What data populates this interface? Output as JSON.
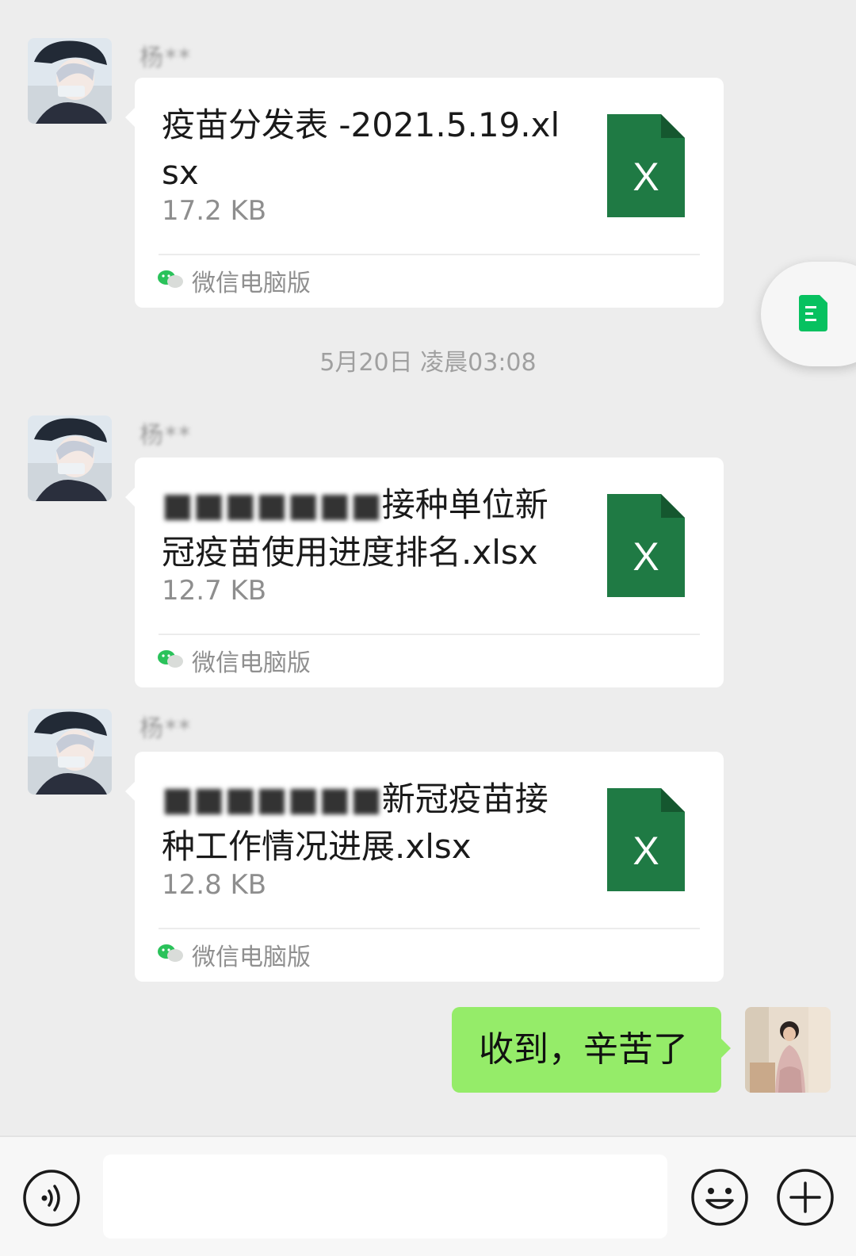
{
  "messages": [
    {
      "sender_name": "杨**",
      "file_name": "疫苗分发表 -2021.5.19.xlsx",
      "file_name_redacted": "",
      "file_size": "17.2 KB",
      "file_icon_letter": "X",
      "source_label": "微信电脑版"
    },
    {
      "sender_name": "杨**",
      "file_name": "接种单位新冠疫苗使用进度排名.xlsx",
      "file_name_redacted": "■■■■■■■",
      "file_size": "12.7 KB",
      "file_icon_letter": "X",
      "source_label": "微信电脑版"
    },
    {
      "sender_name": "杨**",
      "file_name": "新冠疫苗接种工作情况进展.xlsx",
      "file_name_redacted": "■■■■■■■",
      "file_size": "12.8 KB",
      "file_icon_letter": "X",
      "source_label": "微信电脑版"
    }
  ],
  "timestamp": "5月20日 凌晨03:08",
  "my_message": "收到，辛苦了",
  "input": {
    "value": "",
    "placeholder": ""
  },
  "colors": {
    "background": "#ededed",
    "excel_green": "#1f7a44",
    "my_bubble": "#95ec69",
    "wechat_green": "#07c160"
  },
  "icons": {
    "voice": "voice-icon",
    "emoji": "emoji-icon",
    "plus": "plus-icon",
    "float": "document-icon",
    "excel": "excel-file-icon",
    "source": "wechat-logo-icon"
  }
}
